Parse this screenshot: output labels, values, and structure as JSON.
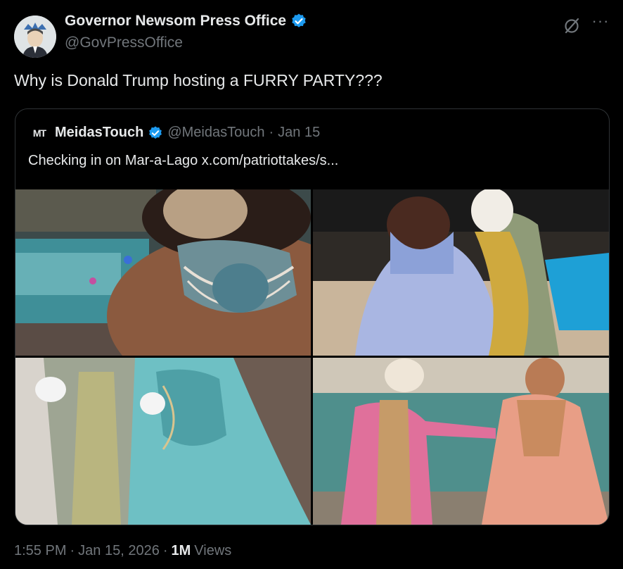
{
  "author": {
    "display_name": "Governor Newsom Press Office",
    "handle": "@GovPressOffice",
    "verified_icon": "verified-badge-icon",
    "avatar_icon": "avatar-icon"
  },
  "tweet": {
    "text": "Why is Donald Trump hosting a FURRY PARTY???"
  },
  "quoted": {
    "logo_text": "MT",
    "display_name": "MeidasTouch",
    "handle": "@MeidasTouch",
    "separator": "·",
    "date": "Jan 15",
    "text": "Checking in on Mar-a-Lago  x.com/patriottakes/s..."
  },
  "meta": {
    "time": "1:55 PM",
    "sep1": "·",
    "date": "Jan 15, 2026",
    "sep2": "·",
    "views_count": "1M",
    "views_label": "Views"
  },
  "colors": {
    "background": "#000000",
    "text": "#e7e9ea",
    "secondary": "#71767b",
    "verified": "#1d9bf0",
    "border": "#2f3336"
  }
}
